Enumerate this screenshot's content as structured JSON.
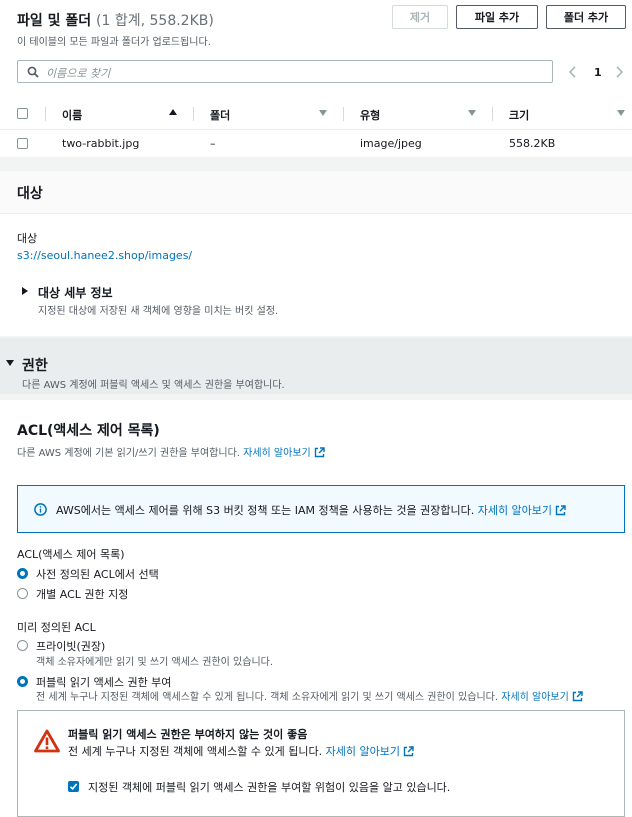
{
  "files": {
    "title": "파일 및 폴더",
    "count": "(1 합계, 558.2KB)",
    "subtitle": "이 테이블의 모든 파일과 폴더가 업로드됩니다.",
    "remove_label": "제거",
    "add_files_label": "파일 추가",
    "add_folder_label": "폴더 추가",
    "search_placeholder": "이름으로 찾기",
    "page_number": "1",
    "columns": [
      "이름",
      "폴더",
      "유형",
      "크기"
    ],
    "rows": [
      {
        "name": "two-rabbit.jpg",
        "folder": "–",
        "type": "image/jpeg",
        "size": "558.2KB"
      }
    ]
  },
  "destination": {
    "heading": "대상",
    "label": "대상",
    "link": "s3://seoul.hanee2.shop/images/",
    "details_title": "대상 세부 정보",
    "details_desc": "지정된 대상에 저장된 새 객체에 영향을 미치는 버킷 설정."
  },
  "permissions": {
    "heading": "권한",
    "desc": "다른 AWS 계정에 퍼블릭 액세스 및 액세스 권한을 부여합니다.",
    "acl_title": "ACL(액세스 제어 목록)",
    "acl_desc": "다른 AWS 계정에 기본 읽기/쓰기 권한을 부여합니다.",
    "learn_more": "자세히 알아보기",
    "info_text": "AWS에서는 액세스 제어를 위해 S3 버킷 정책 또는 IAM 정책을 사용하는 것을 권장합니다.",
    "acl_group_label": "ACL(액세스 제어 목록)",
    "acl_option_predefined": "사전 정의된 ACL에서 선택",
    "acl_option_individual": "개별 ACL 권한 지정",
    "predefined_label": "미리 정의된 ACL",
    "private_label": "프라이빗(권장)",
    "private_desc": "객체 소유자에게만 읽기 및 쓰기 액세스 권한이 있습니다.",
    "public_label": "퍼블릭 읽기 액세스 권한 부여",
    "public_desc": "전 세계 누구나 지정된 객체에 액세스할 수 있게 됩니다. 객체 소유자에게 읽기 및 쓰기 액세스 권한이 있습니다.",
    "warning_title": "퍼블릭 읽기 액세스 권한은 부여하지 않는 것이 좋음",
    "warning_desc": "전 세계 누구나 지정된 객체에 액세스할 수 있게 됩니다.",
    "ack_label": "지정된 객체에 퍼블릭 읽기 액세스 권한을 부여할 위험이 있음을 알고 있습니다."
  },
  "colors": {
    "link": "#0073bb",
    "warning": "#d13212",
    "info_border": "#0073bb"
  },
  "icons": [
    "search-icon",
    "chevron-left-icon",
    "chevron-right-icon",
    "sort-asc-icon",
    "sort-icon",
    "caret-right-icon",
    "caret-down-icon",
    "info-icon",
    "external-link-icon",
    "warning-icon",
    "checkmark-icon"
  ]
}
